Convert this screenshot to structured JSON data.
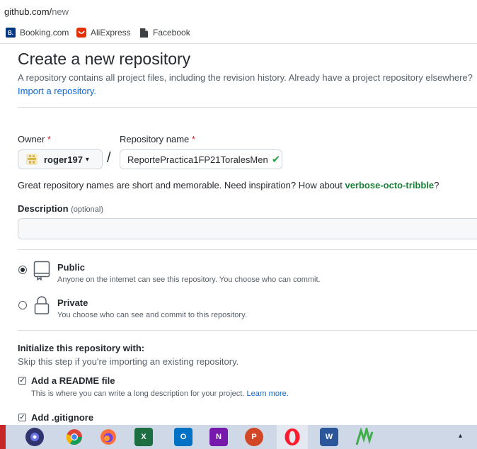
{
  "browser": {
    "url_host": "github.com/",
    "url_path": "new",
    "bookmarks": [
      {
        "label": "Booking.com",
        "icon": "booking-icon",
        "icon_char": "B.",
        "color": "#003580"
      },
      {
        "label": "AliExpress",
        "icon": "aliexpress-icon",
        "icon_char": "◡",
        "color": "#e62e04"
      },
      {
        "label": "Facebook",
        "icon": "file-icon",
        "icon_char": "▙",
        "color": "#3c4043"
      }
    ]
  },
  "page": {
    "title": "Create a new repository",
    "intro": "A repository contains all project files, including the revision history. Already have a project repository elsewhere?",
    "import_link": "Import a repository."
  },
  "form": {
    "owner_label": "Owner",
    "owner_required": "*",
    "owner_value": "roger197",
    "owner_caret": "▾",
    "slash": "/",
    "repo_label": "Repository name",
    "repo_required": "*",
    "repo_value": "ReportePractica1FP21ToralesMen",
    "repo_valid_mark": "✔",
    "hint_prefix": "Great repository names are short and memorable. Need inspiration? How about ",
    "hint_suggestion": "verbose-octo-tribble",
    "hint_suffix": "?",
    "description_label": "Description",
    "description_optional": "(optional)",
    "description_value": ""
  },
  "visibility": {
    "selected": "public",
    "options": [
      {
        "id": "public",
        "title": "Public",
        "desc": "Anyone on the internet can see this repository. You choose who can commit.",
        "icon": "repo-icon"
      },
      {
        "id": "private",
        "title": "Private",
        "desc": "You choose who can see and commit to this repository.",
        "icon": "lock-icon"
      }
    ]
  },
  "initialize": {
    "title": "Initialize this repository with:",
    "subtitle": "Skip this step if you're importing an existing repository.",
    "readme_label": "Add a README file",
    "readme_checked": true,
    "readme_desc": "This is where you can write a long description for your project.",
    "readme_link": "Learn more.",
    "gitignore_label": "Add .gitignore",
    "gitignore_checked": true,
    "check_glyph": "✓"
  },
  "taskbar": {
    "color": "#cfd8e6",
    "apps": [
      {
        "name": "taskbar-app-1-icon",
        "label": "",
        "color": "#3a3f8f"
      },
      {
        "name": "chrome-icon",
        "label": "",
        "color": "#db4437"
      },
      {
        "name": "firefox-icon",
        "label": "",
        "color": "#ff7139"
      },
      {
        "name": "excel-icon",
        "label": "X",
        "color": "#1d6f42"
      },
      {
        "name": "outlook-icon",
        "label": "O",
        "color": "#0072c6"
      },
      {
        "name": "onenote-icon",
        "label": "N",
        "color": "#7719aa"
      },
      {
        "name": "powerpoint-icon",
        "label": "P",
        "color": "#d24726"
      },
      {
        "name": "opera-icon",
        "label": "O",
        "color": "#ff1b2d"
      },
      {
        "name": "word-icon",
        "label": "W",
        "color": "#2b579a"
      },
      {
        "name": "taskbar-app-10-icon",
        "label": "",
        "color": "#3fae49"
      }
    ],
    "tray_caret": "▴"
  }
}
